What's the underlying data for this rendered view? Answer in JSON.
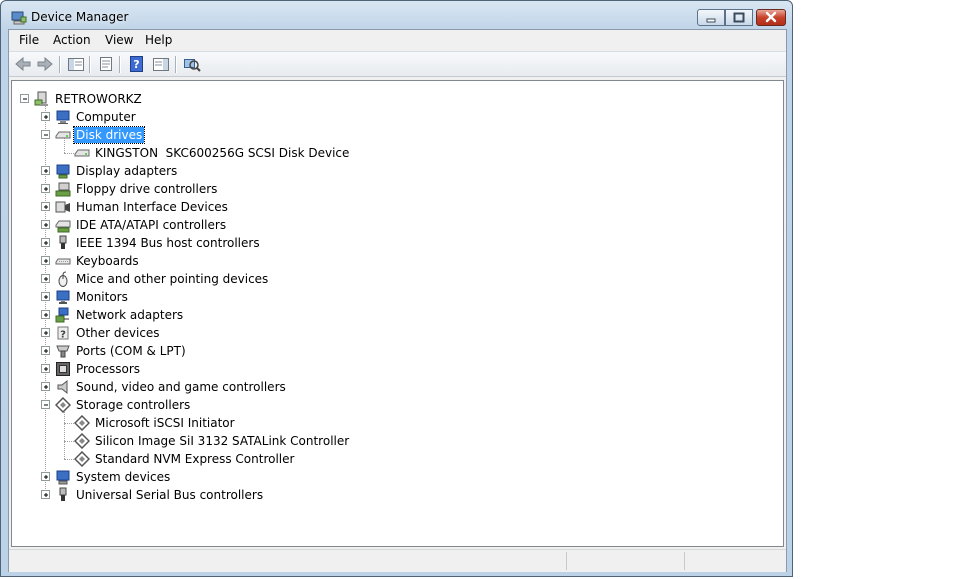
{
  "window": {
    "title": "Device Manager"
  },
  "menu": {
    "file": "File",
    "action": "Action",
    "view": "View",
    "help": "Help"
  },
  "toolbar": {
    "buttons": [
      "back-arrow-icon",
      "forward-arrow-icon",
      "show-hide-console-tree-icon",
      "properties-icon",
      "help-icon",
      "action-pane-icon",
      "scan-hardware-icon"
    ]
  },
  "tree": {
    "root": "RETROWORKZ",
    "categories": [
      {
        "label": "Computer",
        "icon": "computer-icon"
      },
      {
        "label": "Disk drives",
        "icon": "disk-drive-icon"
      },
      {
        "label": "KINGSTON  SKC600256G SCSI Disk Device",
        "icon": "disk-drive-icon"
      },
      {
        "label": "Display adapters",
        "icon": "display-adapter-icon"
      },
      {
        "label": "Floppy drive controllers",
        "icon": "floppy-controller-icon"
      },
      {
        "label": "Human Interface Devices",
        "icon": "hid-icon"
      },
      {
        "label": "IDE ATA/ATAPI controllers",
        "icon": "ide-controller-icon"
      },
      {
        "label": "IEEE 1394 Bus host controllers",
        "icon": "ieee1394-icon"
      },
      {
        "label": "Keyboards",
        "icon": "keyboard-icon"
      },
      {
        "label": "Mice and other pointing devices",
        "icon": "mouse-icon"
      },
      {
        "label": "Monitors",
        "icon": "monitor-icon"
      },
      {
        "label": "Network adapters",
        "icon": "network-adapter-icon"
      },
      {
        "label": "Other devices",
        "icon": "unknown-device-icon"
      },
      {
        "label": "Ports (COM & LPT)",
        "icon": "port-icon"
      },
      {
        "label": "Processors",
        "icon": "processor-icon"
      },
      {
        "label": "Sound, video and game controllers",
        "icon": "speaker-icon"
      },
      {
        "label": "Storage controllers",
        "icon": "storage-controller-icon"
      },
      {
        "label": "Microsoft iSCSI Initiator",
        "icon": "storage-controller-icon"
      },
      {
        "label": "Silicon Image SiI 3132 SATALink Controller",
        "icon": "storage-controller-icon"
      },
      {
        "label": "Standard NVM Express Controller",
        "icon": "storage-controller-icon"
      },
      {
        "label": "System devices",
        "icon": "system-device-icon"
      },
      {
        "label": "Universal Serial Bus controllers",
        "icon": "usb-icon"
      }
    ]
  },
  "colors": {
    "selection": "#3399ff",
    "frame": "#bcd2e6",
    "close_button": "#c7422a"
  }
}
